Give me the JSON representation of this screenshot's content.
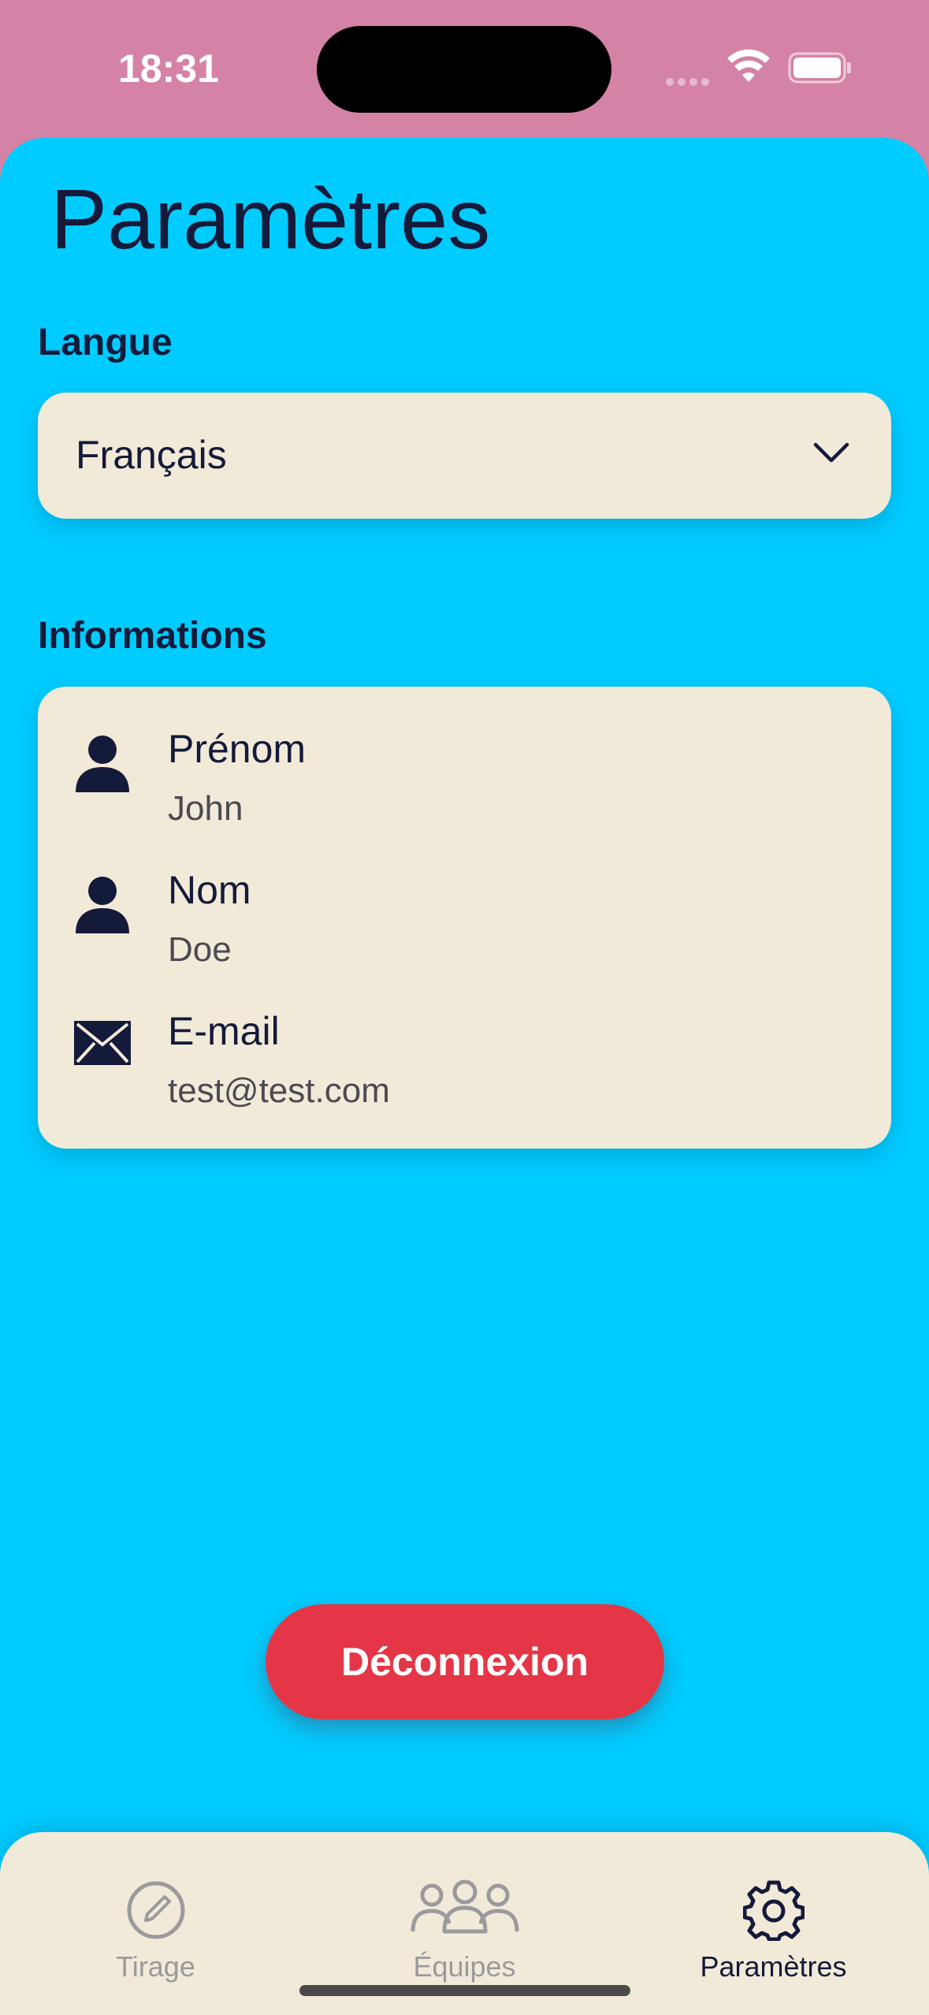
{
  "status_bar": {
    "time": "18:31",
    "icons": [
      "signal-icon",
      "wifi-icon",
      "battery-icon"
    ]
  },
  "page": {
    "title": "Paramètres"
  },
  "language": {
    "section_label": "Langue",
    "selected": "Français",
    "icon": "chevron-down-icon"
  },
  "informations": {
    "section_label": "Informations",
    "rows": [
      {
        "icon": "person-icon",
        "label": "Prénom",
        "value": "John"
      },
      {
        "icon": "person-icon",
        "label": "Nom",
        "value": "Doe"
      },
      {
        "icon": "envelope-icon",
        "label": "E-mail",
        "value": "test@test.com"
      }
    ]
  },
  "logout": {
    "label": "Déconnexion"
  },
  "tab_bar": {
    "tabs": [
      {
        "label": "Tirage",
        "icon": "pencil-circle-icon",
        "active": false
      },
      {
        "label": "Équipes",
        "icon": "group-icon",
        "active": false
      },
      {
        "label": "Paramètres",
        "icon": "gear-icon",
        "active": true
      }
    ]
  },
  "colors": {
    "status_background": "#d482a6",
    "page_background": "#00ccff",
    "card_background": "#f2ead8",
    "text_primary": "#141a3a",
    "danger": "#e43646"
  }
}
